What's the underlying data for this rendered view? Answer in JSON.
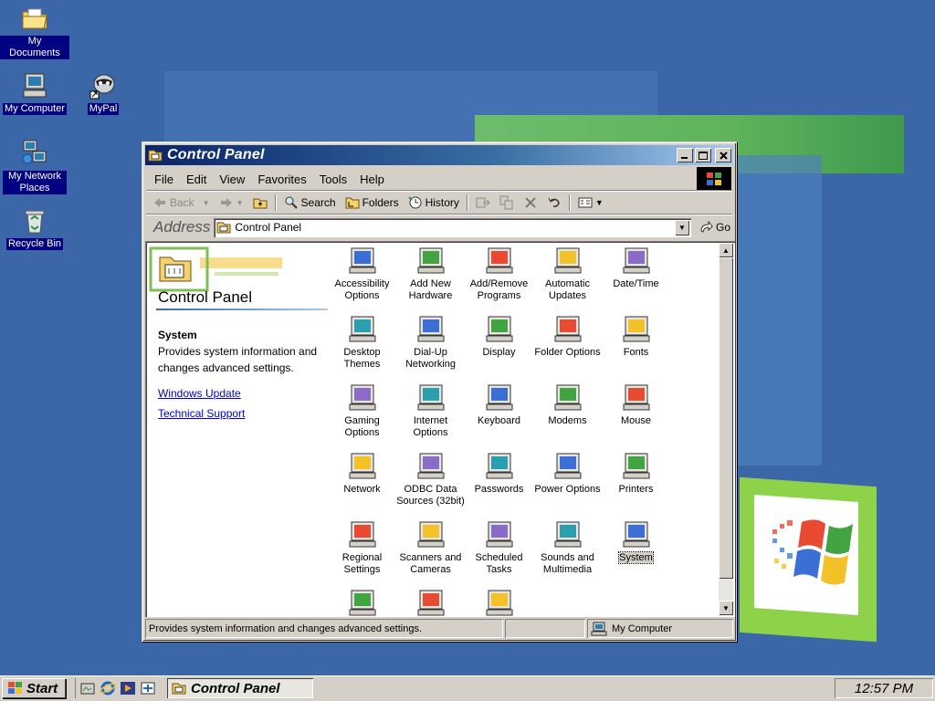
{
  "desktop": {
    "icons": [
      {
        "label": "My Documents",
        "icon": "folder-icon"
      },
      {
        "label": "My Computer",
        "icon": "computer-icon"
      },
      {
        "label": "MyPal",
        "icon": "mypal-icon"
      },
      {
        "label": "My Network Places",
        "icon": "network-places-icon"
      },
      {
        "label": "Recycle Bin",
        "icon": "recycle-bin-icon"
      }
    ]
  },
  "window": {
    "title": "Control Panel",
    "menus": [
      "File",
      "Edit",
      "View",
      "Favorites",
      "Tools",
      "Help"
    ],
    "menu_accels": [
      "F",
      "E",
      "V",
      "a",
      "T",
      "H"
    ],
    "toolbar": {
      "back": "Back",
      "search": "Search",
      "folders": "Folders",
      "history": "History"
    },
    "address": {
      "label": "Address",
      "value": "Control Panel",
      "go": "Go"
    }
  },
  "left_pane": {
    "title": "Control Panel",
    "selected_name": "System",
    "selected_desc": "Provides system information and changes advanced settings.",
    "links": [
      "Windows Update",
      "Technical Support"
    ]
  },
  "control_panel_items": [
    {
      "label": "Accessibility Options",
      "icon": "accessibility-icon"
    },
    {
      "label": "Add New Hardware",
      "icon": "add-hardware-icon"
    },
    {
      "label": "Add/Remove Programs",
      "icon": "add-remove-programs-icon"
    },
    {
      "label": "Automatic Updates",
      "icon": "automatic-updates-icon"
    },
    {
      "label": "Date/Time",
      "icon": "date-time-icon"
    },
    {
      "label": "Desktop Themes",
      "icon": "desktop-themes-icon"
    },
    {
      "label": "Dial-Up Networking",
      "icon": "dialup-networking-icon"
    },
    {
      "label": "Display",
      "icon": "display-icon"
    },
    {
      "label": "Folder Options",
      "icon": "folder-options-icon"
    },
    {
      "label": "Fonts",
      "icon": "fonts-icon"
    },
    {
      "label": "Gaming Options",
      "icon": "gaming-options-icon"
    },
    {
      "label": "Internet Options",
      "icon": "internet-options-icon"
    },
    {
      "label": "Keyboard",
      "icon": "keyboard-icon"
    },
    {
      "label": "Modems",
      "icon": "modems-icon"
    },
    {
      "label": "Mouse",
      "icon": "mouse-icon"
    },
    {
      "label": "Network",
      "icon": "network-icon"
    },
    {
      "label": "ODBC Data Sources (32bit)",
      "icon": "odbc-icon"
    },
    {
      "label": "Passwords",
      "icon": "passwords-icon"
    },
    {
      "label": "Power Options",
      "icon": "power-options-icon"
    },
    {
      "label": "Printers",
      "icon": "printers-icon"
    },
    {
      "label": "Regional Settings",
      "icon": "regional-settings-icon"
    },
    {
      "label": "Scanners and Cameras",
      "icon": "scanners-cameras-icon"
    },
    {
      "label": "Scheduled Tasks",
      "icon": "scheduled-tasks-icon"
    },
    {
      "label": "Sounds and Multimedia",
      "icon": "sounds-multimedia-icon"
    },
    {
      "label": "System",
      "icon": "system-icon",
      "selected": true
    },
    {
      "label": "",
      "icon": "system-info-icon"
    },
    {
      "label": "",
      "icon": "network-computers-icon"
    },
    {
      "label": "",
      "icon": "users-icon"
    }
  ],
  "statusbar": {
    "message": "Provides system information and changes advanced settings.",
    "zone": "My Computer"
  },
  "taskbar": {
    "start": "Start",
    "task": "Control Panel",
    "clock": "12:57 PM"
  },
  "colors": {
    "desktop": "#3a6ea5",
    "titlebar_active": "#0a246a",
    "face": "#d4d0c8",
    "link": "#0000cc"
  }
}
